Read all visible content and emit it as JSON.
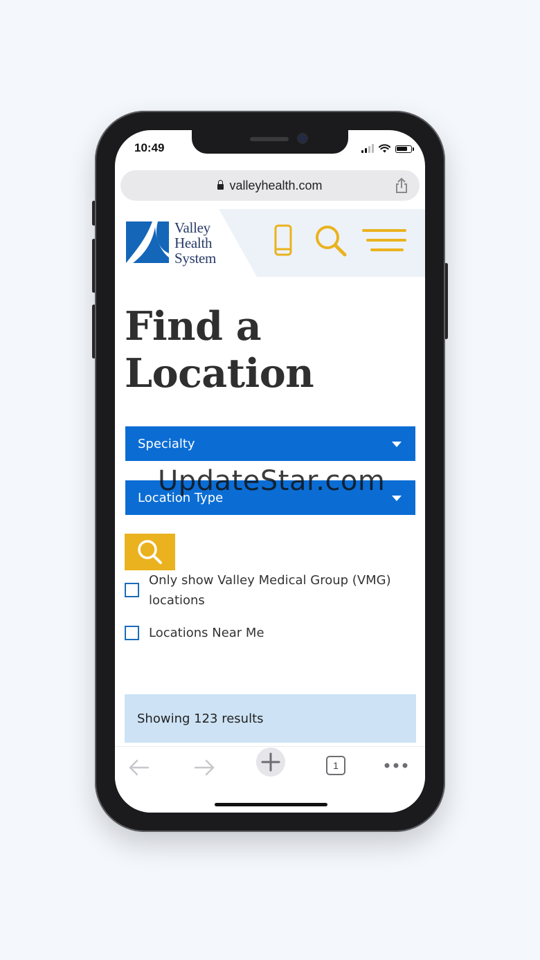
{
  "status_bar": {
    "time": "10:49"
  },
  "browser": {
    "url": "valleyhealth.com",
    "tab_count": "1"
  },
  "site": {
    "logo_lines": [
      "Valley",
      "Health",
      "System"
    ],
    "colors": {
      "brand_blue": "#0b6dd4",
      "accent_yellow": "#eab21e",
      "logo_blue": "#1466b8"
    }
  },
  "page": {
    "title_line1": "Find a",
    "title_line2": "Location",
    "specialty_dropdown": "Specialty",
    "location_type_dropdown": "Location Type",
    "vmg_checkbox_line1": "Only show Valley Medical Group (VMG)",
    "vmg_checkbox_line2": "locations",
    "near_me_checkbox": "Locations Near Me",
    "results_text": "Showing 123 results"
  },
  "watermark": "UpdateStar.com"
}
